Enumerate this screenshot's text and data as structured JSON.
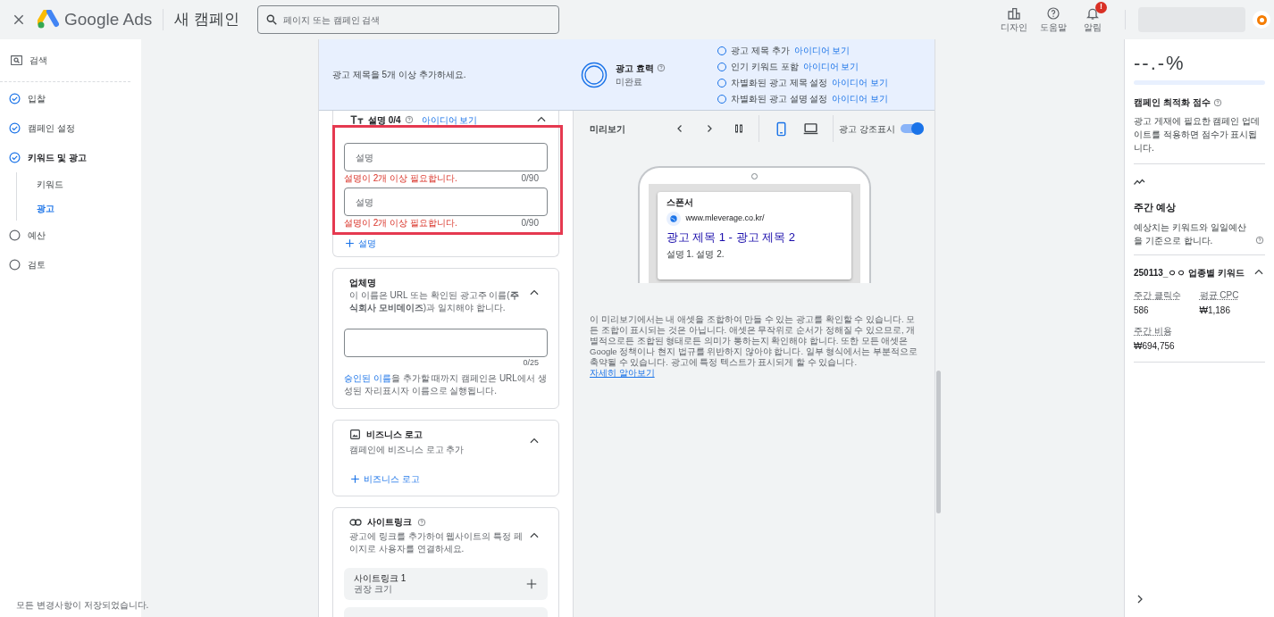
{
  "topbar": {
    "brand": "Google Ads",
    "title": "새 캠페인",
    "search": {
      "placeholder": "페이지 또는 캠페인 검색"
    },
    "actions": [
      {
        "kind": "design",
        "label": "디자인"
      },
      {
        "kind": "help",
        "label": "도움말"
      },
      {
        "kind": "bell",
        "label": "알림",
        "badge": "!"
      }
    ]
  },
  "sidebar": {
    "campaign_type": "검색",
    "steps": [
      {
        "label": "입찰",
        "done": true,
        "selected": false
      },
      {
        "label": "캠페인 설정",
        "done": true,
        "selected": false
      },
      {
        "label": "키워드 및 광고",
        "done": true,
        "selected": true,
        "children": [
          {
            "label": "키워드",
            "selected": false
          },
          {
            "label": "광고",
            "selected": true
          }
        ]
      },
      {
        "label": "예산",
        "done": false,
        "selected": false
      },
      {
        "label": "검토",
        "done": false,
        "selected": false
      }
    ],
    "save_status": "모든 변경사항이 저장되었습니다."
  },
  "banner": {
    "message": "광고 제목을 5개 이상 추가하세요.",
    "strength": {
      "title": "광고 효력",
      "status": "미완료"
    },
    "tips": [
      {
        "text": "광고 제목 추가",
        "link": "아이디어 보기",
        "done": false
      },
      {
        "text": "인기 키워드 포함",
        "link": "아이디어 보기",
        "done": false
      },
      {
        "text": "차별화된 광고 제목 설정",
        "link": "아이디어 보기",
        "done": false
      },
      {
        "text": "차별화된 광고 설명 설정",
        "link": "아이디어 보기",
        "done": false
      }
    ]
  },
  "descriptions": {
    "title": "설명 0/4",
    "ideas_link": "아이디어 보기",
    "expanded": true,
    "fields": [
      {
        "placeholder": "설명",
        "error": "설명이 2개 이상 필요합니다.",
        "counter": "0/90"
      },
      {
        "placeholder": "설명",
        "error": "설명이 2개 이상 필요합니다.",
        "counter": "0/90"
      }
    ],
    "add": "설명"
  },
  "business_name": {
    "title": "업체명",
    "note": "이 이름은 URL 또는 확인된 광고주 이름(**주식회사 모비데이즈**)과 일치해야 합니다.",
    "counter": "0/25",
    "hint_link": "승인된 이름",
    "hint": "을 추가할 때까지 캠페인은 URL에서 생성된 자리표시자 이름으로 실행됩니다.",
    "expanded": true
  },
  "business_logo": {
    "title": "비즈니스 로고",
    "subtitle": "캠페인에 비즈니스 로고 추가",
    "add": "비즈니스 로고",
    "expanded": true
  },
  "sitelinks": {
    "title": "사이트링크",
    "subtitle": "광고에 링크를 추가하여 웹사이트의 특정 페이지로 사용자를 연결하세요.",
    "expanded": true,
    "items": [
      {
        "name": "사이트링크 1",
        "hint": "권장 크기"
      }
    ]
  },
  "preview": {
    "title": "미리보기",
    "devices": [
      {
        "kind": "mobile",
        "selected": true
      },
      {
        "kind": "desktop",
        "selected": false
      }
    ],
    "highlight": {
      "label": "광고 강조표시",
      "on": true
    },
    "ad": {
      "sponsor": "스폰서",
      "url": "www.mleverage.co.kr/",
      "headline": "광고 제목 1 - 광고 제목 2",
      "description": "설명 1. 설명 2."
    },
    "notice": "이 미리보기에서는 내 애셋을 조합하여 만들 수 있는 광고를 확인할 수 있습니다. 모든 조합이 표시되는 것은 아닙니다. 애셋은 무작위로 순서가 정해질 수 있으므로, 개별적으로든 조합된 형태로든 의미가 통하는지 확인해야 합니다. 또한 모든 애셋은 Google 정책이나 현지 법규를 위반하지 않아야 합니다. 일부 형식에서는 부분적으로 축약될 수 있습니다. 광고에 특정 텍스트가 표시되게 할 수 있습니다.",
    "notice_link": "자세히 알아보기"
  },
  "summary": {
    "score": "--.-%",
    "level": 0,
    "score_title": "캠페인 최적화 점수",
    "score_note": "광고 게재에 필요한 캠페인 업데이트를 적용하면 점수가 표시됩니다.",
    "forecast_title": "주간 예상",
    "forecast_note": "예상치는 키워드와 일일예산을 기준으로 합니다.",
    "group": {
      "name": "250113_ㅇㅇ 업종별 키워드",
      "expanded": true,
      "stats": [
        {
          "label": "주간 클릭수",
          "value": "586"
        },
        {
          "label": "평균 CPC",
          "value": "₩1,186"
        },
        {
          "label": "주간 비용",
          "value": "₩694,756"
        }
      ]
    }
  }
}
